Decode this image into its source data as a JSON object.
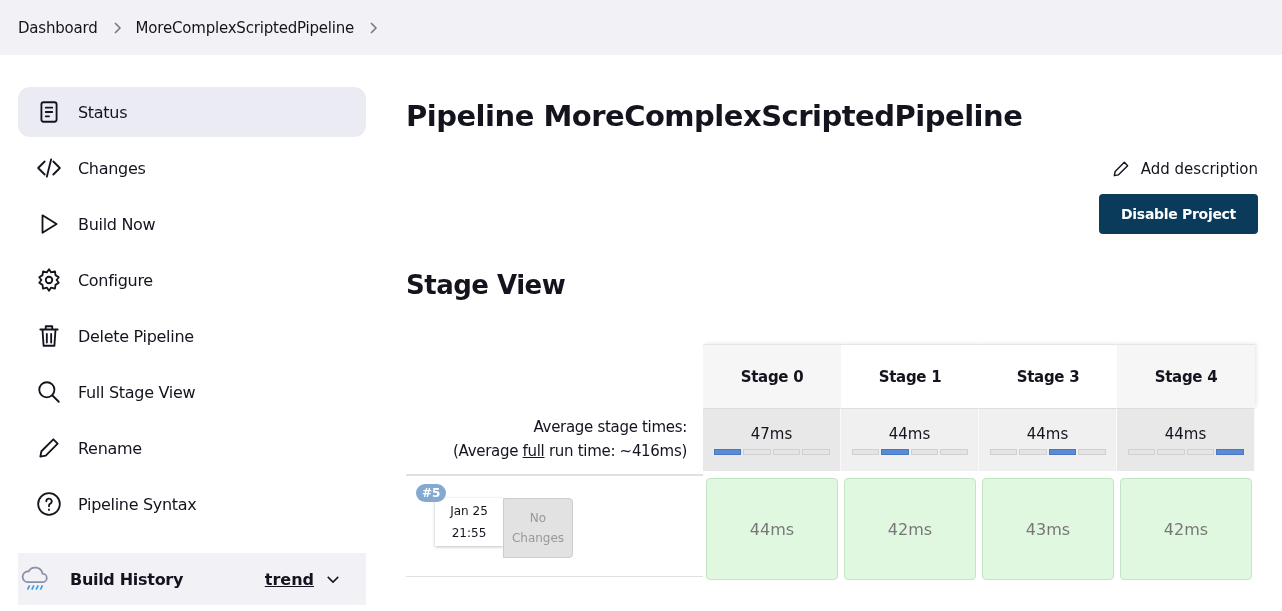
{
  "breadcrumbs": [
    {
      "label": "Dashboard"
    },
    {
      "label": "MoreComplexScriptedPipeline"
    }
  ],
  "sidebar": {
    "items": [
      {
        "kind": "document",
        "label": "Status",
        "selected": true
      },
      {
        "kind": "code",
        "label": "Changes",
        "selected": false
      },
      {
        "kind": "play",
        "label": "Build Now",
        "selected": false
      },
      {
        "kind": "gear",
        "label": "Configure",
        "selected": false
      },
      {
        "kind": "trash",
        "label": "Delete Pipeline",
        "selected": false
      },
      {
        "kind": "search",
        "label": "Full Stage View",
        "selected": false
      },
      {
        "kind": "pencil",
        "label": "Rename",
        "selected": false
      },
      {
        "kind": "help",
        "label": "Pipeline Syntax",
        "selected": false
      }
    ],
    "build_history": {
      "title": "Build History",
      "trend_link": "trend"
    }
  },
  "page_title": "Pipeline MoreComplexScriptedPipeline",
  "add_description": "Add description",
  "disable_button": "Disable Project",
  "stage_view": {
    "title": "Stage View",
    "average_label": "Average stage times:",
    "average_run": {
      "before": "(Average ",
      "underlined": "full",
      "after": " run time: ~416ms)"
    },
    "stages": [
      {
        "name": "Stage 0",
        "average": "47ms"
      },
      {
        "name": "Stage 1",
        "average": "44ms"
      },
      {
        "name": "Stage 3",
        "average": "44ms"
      },
      {
        "name": "Stage 4",
        "average": "44ms"
      }
    ],
    "builds": [
      {
        "number": "#5",
        "date": "Jan 25",
        "time": "21:55",
        "changes": "No Changes",
        "cells": [
          {
            "time": "44ms",
            "kind": "success"
          },
          {
            "time": "42ms",
            "kind": "success"
          },
          {
            "time": "43ms",
            "kind": "success"
          },
          {
            "time": "42ms",
            "kind": "success"
          }
        ]
      }
    ]
  }
}
